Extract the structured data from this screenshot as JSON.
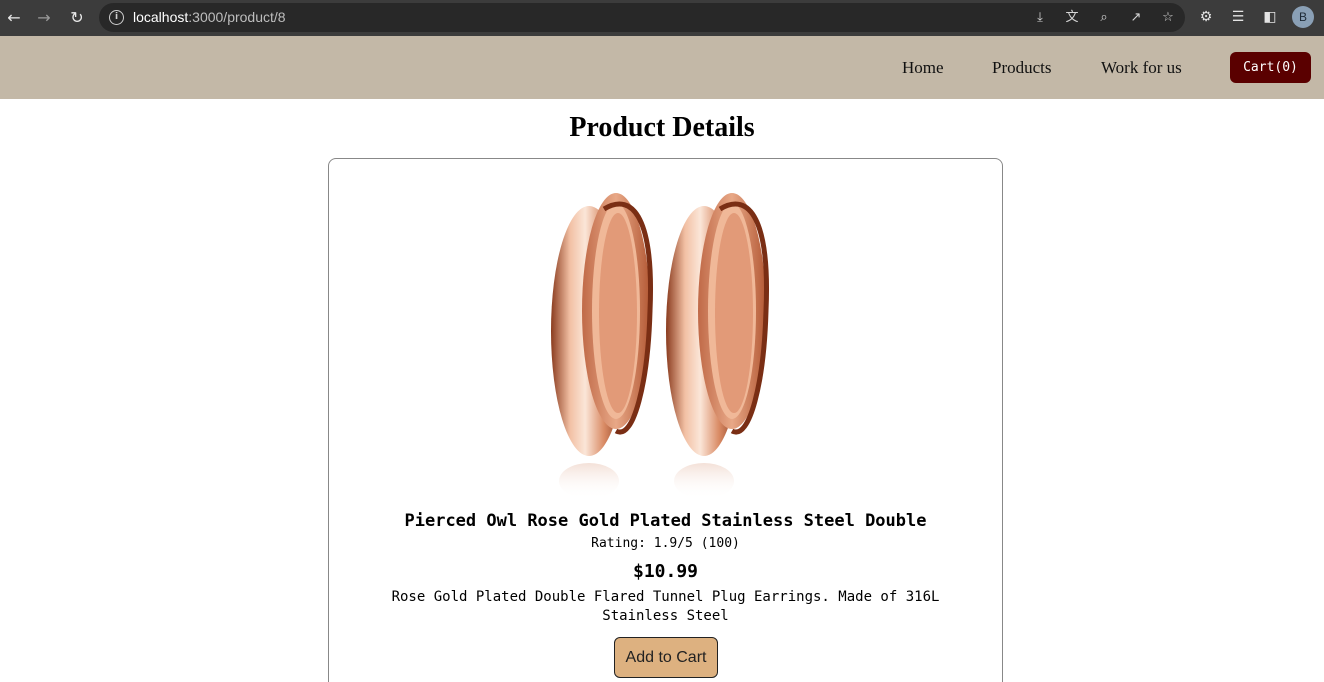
{
  "browser": {
    "url_host": "localhost",
    "url_path": ":3000/product/8",
    "profile_initial": "B"
  },
  "header": {
    "nav": [
      {
        "label": "Home"
      },
      {
        "label": "Products"
      },
      {
        "label": "Work for us"
      }
    ],
    "cart_label": "Cart(0)"
  },
  "page": {
    "title": "Product Details"
  },
  "product": {
    "name": "Pierced Owl Rose Gold Plated Stainless Steel Double",
    "rating": "Rating: 1.9/5 (100)",
    "price": "$10.99",
    "description": "Rose Gold Plated Double Flared Tunnel Plug Earrings. Made of 316L Stainless Steel",
    "add_to_cart_label": "Add to Cart"
  },
  "colors": {
    "header_bg": "#c3b8a7",
    "cart_bg": "#5a0000",
    "add_btn_bg": "#ddb180",
    "rose_gold": "#d48b6b"
  }
}
